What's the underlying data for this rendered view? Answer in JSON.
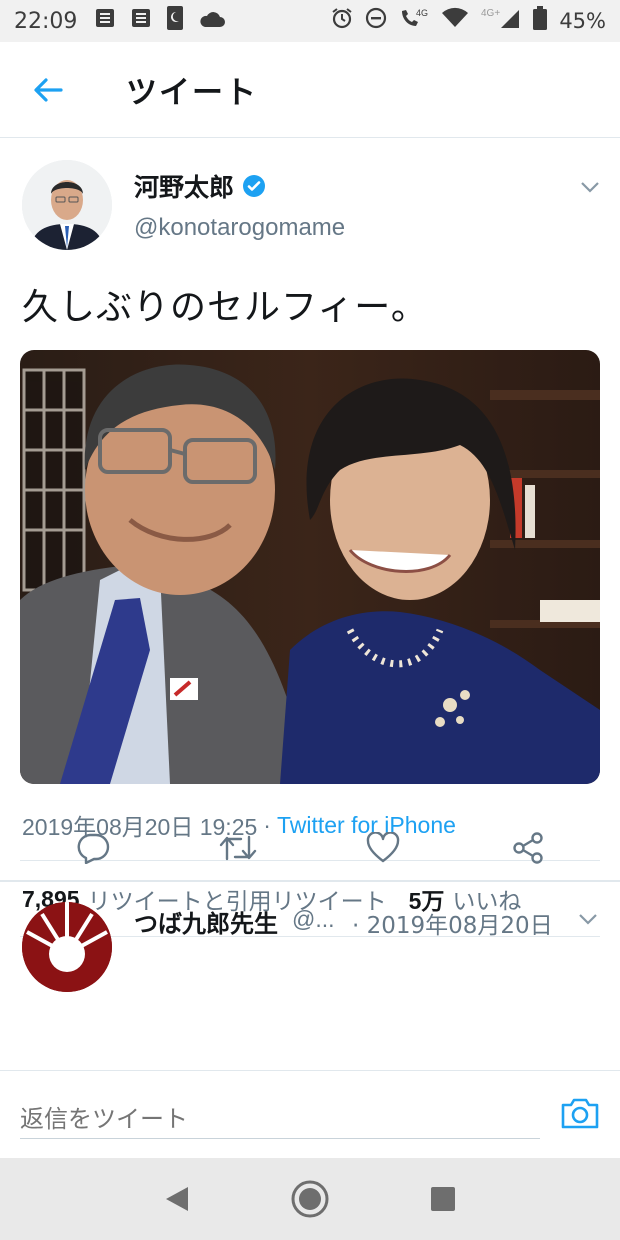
{
  "status_bar": {
    "time": "22:09",
    "network": "4G",
    "network2": "4G+",
    "battery": "45%"
  },
  "header": {
    "title": "ツイート"
  },
  "tweet": {
    "display_name": "河野太郎",
    "handle": "@konotarogomame",
    "text": "久しぶりのセルフィー。",
    "timestamp": "2019年08月20日 19:25",
    "separator": "·",
    "source": "Twitter for iPhone",
    "retweets_count": "7,895",
    "retweets_label": "リツイートと引用リツイート",
    "likes_count": "5万",
    "likes_label": "いいね"
  },
  "reply_preview": {
    "display_name": "つば九郎先生",
    "handle": "@...",
    "date": "· 2019年08月20日"
  },
  "composer": {
    "placeholder": "返信をツイート"
  },
  "colors": {
    "accent": "#1da1f2",
    "text": "#14171a",
    "secondary": "#657786",
    "divider": "#e1e8ed"
  },
  "icons": {
    "back": "arrow-left-icon",
    "verified": "verified-badge-icon",
    "caret": "chevron-down-icon",
    "reply": "comment-icon",
    "retweet": "retweet-icon",
    "like": "heart-icon",
    "share": "share-icon",
    "camera": "camera-icon",
    "nav_back": "triangle-back-icon",
    "nav_home": "circle-home-icon",
    "nav_recent": "square-recents-icon"
  }
}
